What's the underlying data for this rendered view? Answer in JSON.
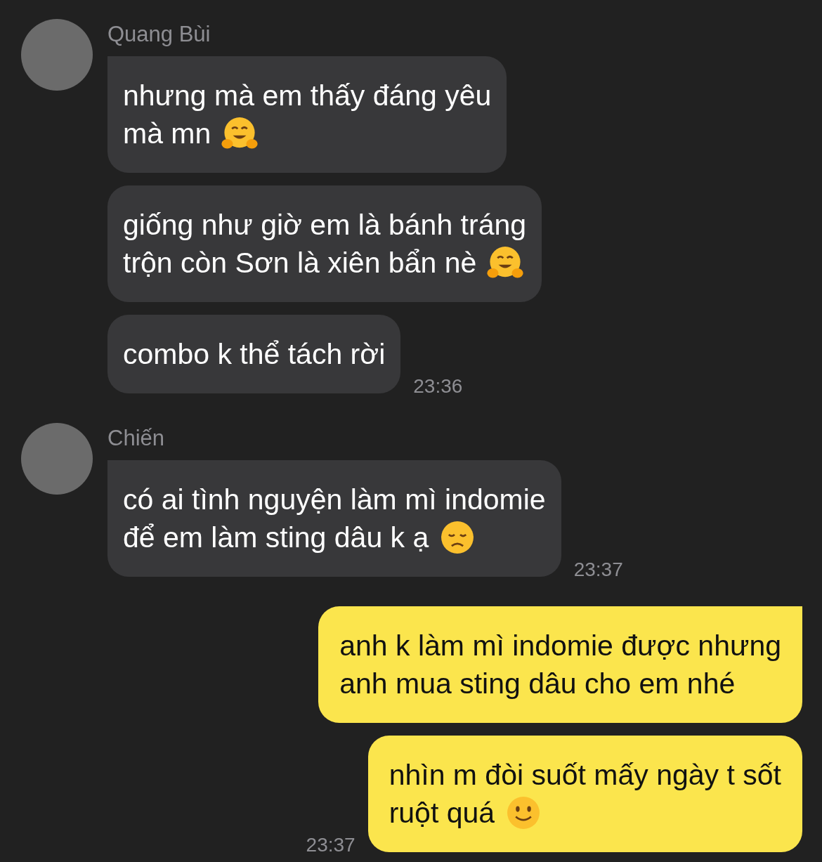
{
  "groups": [
    {
      "kind": "received",
      "sender": "Quang Bùi",
      "time": "23:36",
      "messages": [
        {
          "text": "nhưng mà em thấy đáng yêu\nmà mn",
          "kind": "hug"
        },
        {
          "text": "giống như giờ em là bánh tráng\ntrộn còn Sơn là xiên bẩn nè",
          "kind": "hug"
        },
        {
          "text": "combo k thể tách rời",
          "kind": "plain"
        }
      ]
    },
    {
      "kind": "received",
      "sender": "Chiến",
      "time": "23:37",
      "messages": [
        {
          "text": "có ai tình nguyện làm mì indomie\nđể em làm sting dâu k ạ",
          "kind": "sad"
        }
      ]
    },
    {
      "kind": "sent",
      "time": "23:37",
      "messages": [
        {
          "text": "anh k làm mì indomie được nhưng\nanh mua sting dâu cho em nhé",
          "kind": "plain"
        },
        {
          "text": "nhìn m đòi suốt mấy ngày t sốt\nruột quá",
          "kind": "smile"
        }
      ]
    }
  ]
}
